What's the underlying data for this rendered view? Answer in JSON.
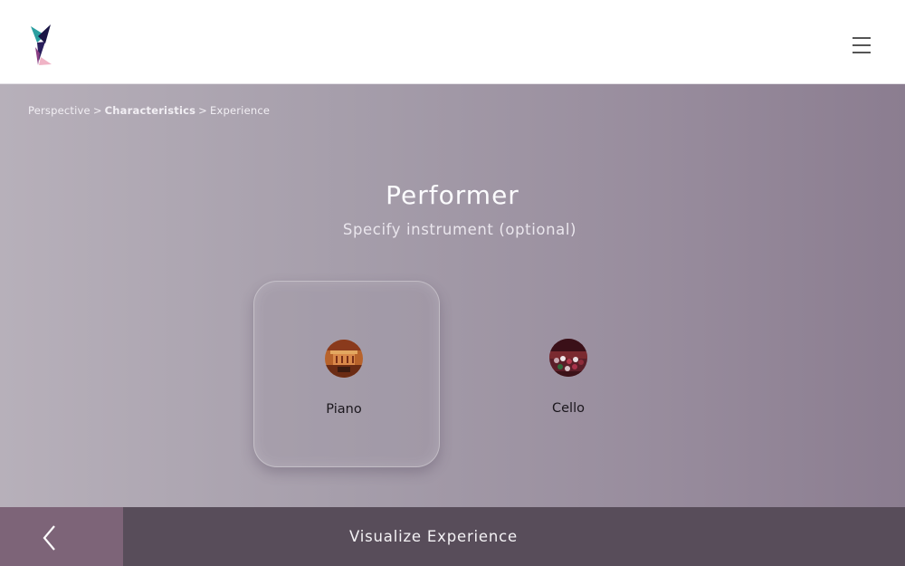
{
  "header": {
    "logo_icon": "brand-logo-icon",
    "menu_icon": "hamburger-menu-icon"
  },
  "breadcrumb": {
    "items": [
      {
        "label": "Perspective"
      },
      {
        "label": "Characteristics"
      },
      {
        "label": "Experience"
      }
    ],
    "separator": ">"
  },
  "page": {
    "title": "Performer",
    "subtitle": "Specify instrument (optional)"
  },
  "instruments": [
    {
      "label": "Piano",
      "icon": "piano-thumbnail-icon",
      "selected": true
    },
    {
      "label": "Cello",
      "icon": "cello-thumbnail-icon",
      "selected": false
    }
  ],
  "footer": {
    "back_icon": "chevron-left-icon",
    "visualize_label": "Visualize Experience"
  },
  "colors": {
    "back_button": "#7d6478",
    "visualize_button": "#584d5a",
    "background_gradient_start": "#b7b0ba",
    "background_gradient_end": "#8b7d90"
  }
}
